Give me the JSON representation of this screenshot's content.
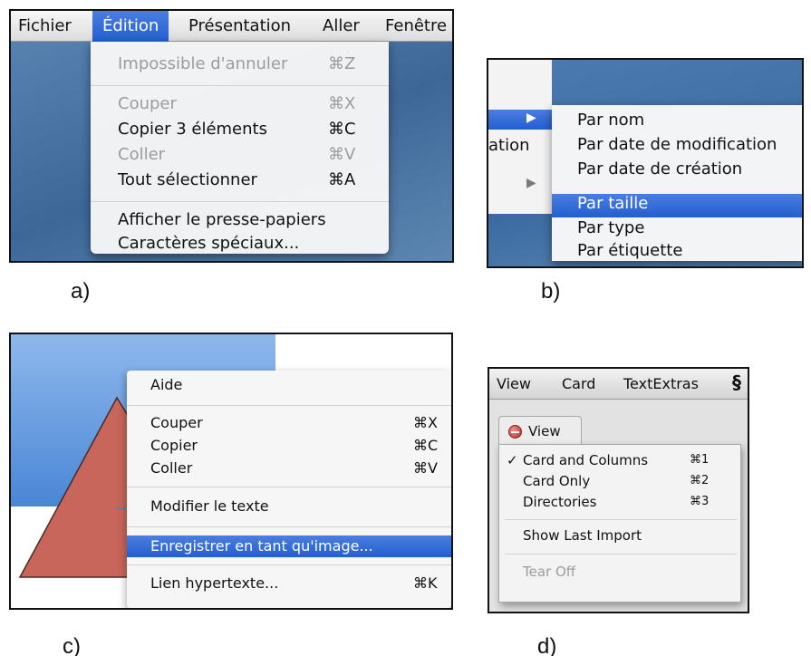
{
  "panel_a": {
    "menubar": [
      "Fichier",
      "Édition",
      "Présentation",
      "Aller",
      "Fenêtre"
    ],
    "menu": {
      "undo": {
        "label": "Impossible d'annuler",
        "shortcut": "⌘Z"
      },
      "cut": {
        "label": "Couper",
        "shortcut": "⌘X"
      },
      "copy": {
        "label": "Copier 3 éléments",
        "shortcut": "⌘C"
      },
      "paste": {
        "label": "Coller",
        "shortcut": "⌘V"
      },
      "select_all": {
        "label": "Tout sélectionner",
        "shortcut": "⌘A"
      },
      "clipboard": {
        "label": "Afficher le presse-papiers"
      },
      "special_chars": {
        "label": "Caractères spéciaux..."
      }
    },
    "caption": "a)"
  },
  "panel_b": {
    "parent_item_fragment": "ation",
    "arrow": "▶",
    "submenu": [
      "Par nom",
      "Par date de modification",
      "Par date de création",
      "Par taille",
      "Par type",
      "Par étiquette"
    ],
    "caption": "b)"
  },
  "panel_c": {
    "menu": {
      "help": "Aide",
      "cut": {
        "label": "Couper",
        "shortcut": "⌘X"
      },
      "copy": {
        "label": "Copier",
        "shortcut": "⌘C"
      },
      "paste": {
        "label": "Coller",
        "shortcut": "⌘V"
      },
      "edit_text": "Modifier le texte",
      "save_as_image": "Enregistrer en tant qu'image...",
      "hyperlink": {
        "label": "Lien hypertexte...",
        "shortcut": "⌘K"
      }
    },
    "caption": "c)"
  },
  "panel_d": {
    "menubar": [
      "View",
      "Card",
      "TextExtras"
    ],
    "script_icon": "§",
    "tab_label": "View",
    "checkmark": "✓",
    "menu": {
      "card_columns": {
        "label": "Card and Columns",
        "shortcut": "⌘1"
      },
      "card_only": {
        "label": "Card Only",
        "shortcut": "⌘2"
      },
      "directories": {
        "label": "Directories",
        "shortcut": "⌘3"
      },
      "show_last_import": "Show Last Import",
      "tear_off": "Tear Off"
    },
    "caption": "d)"
  },
  "colors": {
    "selection": "#2f6be0",
    "desktop_blue": "#4a76a8",
    "shape_red": "#c8665b"
  }
}
